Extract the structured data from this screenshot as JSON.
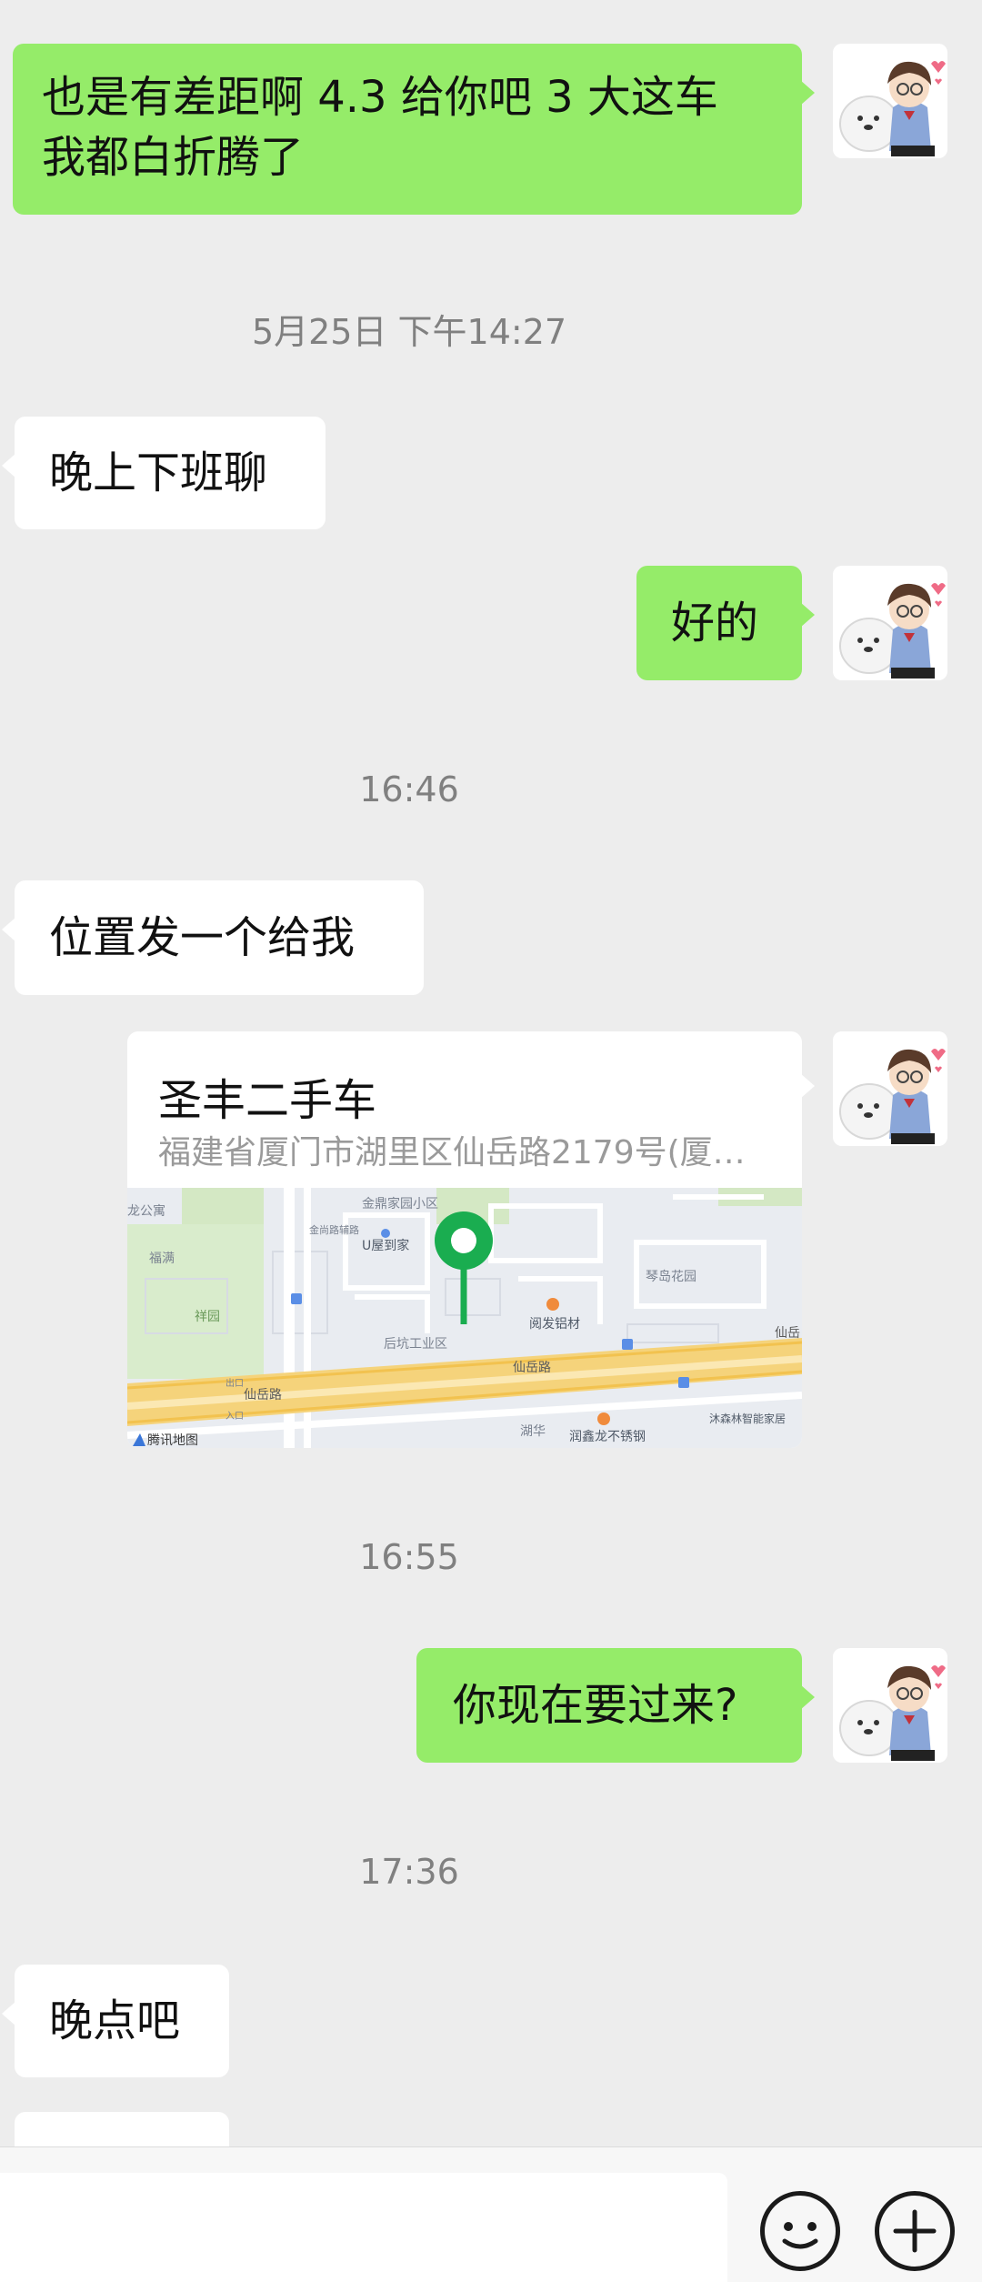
{
  "messages": {
    "m1": {
      "line1": "也是有差距啊 4.3 给你吧 3 大这车",
      "line2": "我都白折腾了"
    },
    "ts1": "5月25日 下午14:27",
    "m2": "晚上下班聊",
    "m3": "好的",
    "ts2": "16:46",
    "m4": "位置发一个给我",
    "location": {
      "title": "圣丰二手车",
      "address": "福建省厦门市湖里区仙岳路2179号(厦…",
      "map_labels": {
        "road_main": "仙岳路",
        "road_main2": "仙岳路",
        "road_east": "仙岳",
        "park": "祥园",
        "industrial": "后坑工业区",
        "garden": "琴岛花园",
        "community": "金鼎家园小区",
        "shop": "阅发铝材",
        "home": "U屋到家",
        "apt": "龙公寓",
        "south": "湖华",
        "south_shop": "润鑫龙不锈钢",
        "furniture": "沐森林智能家居",
        "west": "福满",
        "road_v": "金尚路辅路",
        "badge1": "出口",
        "badge2": "入口",
        "provider": "腾讯地图"
      }
    },
    "ts3": "16:55",
    "m5": "你现在要过来?",
    "ts4": "17:36",
    "m6": "晚点吧"
  },
  "colors": {
    "outgoing_bubble": "#95ec69",
    "incoming_bubble": "#ffffff",
    "background": "#ededed",
    "pin": "#1aad50"
  },
  "icons": {
    "emoji": "emoji-face-icon",
    "plus": "plus-circle-icon",
    "pin": "location-pin-icon",
    "avatar": "avatar-boy-with-dog"
  }
}
